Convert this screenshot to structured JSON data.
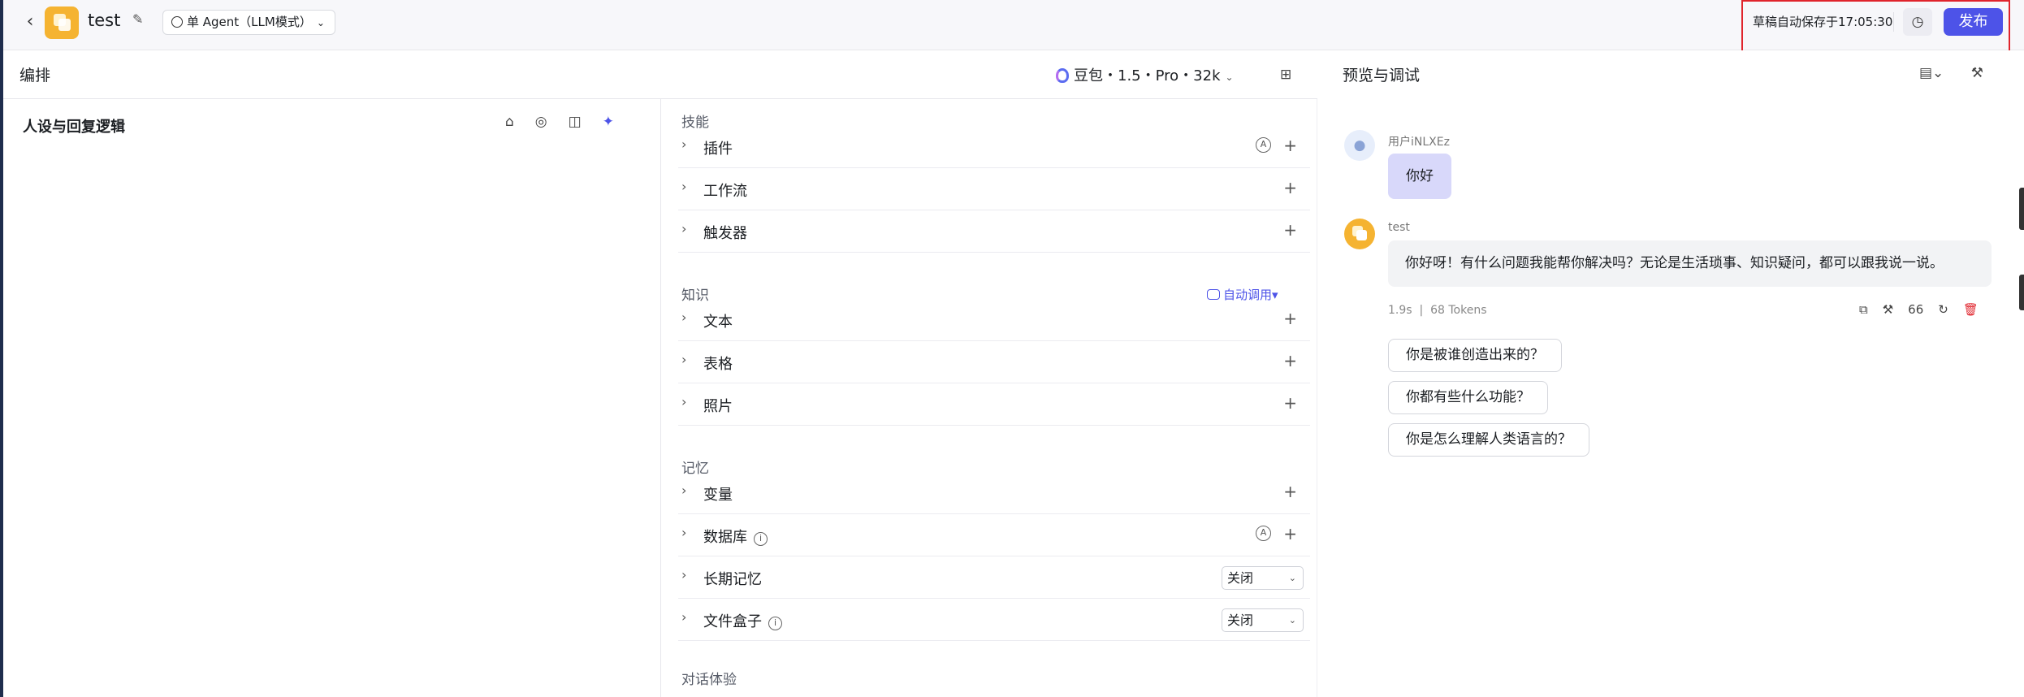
{
  "topbar": {
    "app_name": "test",
    "agent_mode": "单 Agent（LLM模式）",
    "autosave": "草稿自动保存于17:05:30",
    "publish_label": "发布"
  },
  "arrange": {
    "title": "编排",
    "model": "豆包・1.5・Pro・32k"
  },
  "persona": {
    "title": "人设与回复逻辑"
  },
  "skills": {
    "skills_title": "技能",
    "plugins": "插件",
    "workflow": "工作流",
    "trigger": "触发器",
    "knowledge_title": "知识",
    "auto_call": "自动调用",
    "text": "文本",
    "table": "表格",
    "photo": "照片",
    "memory_title": "记忆",
    "variable": "变量",
    "database": "数据库",
    "long_memory": "长期记忆",
    "long_memory_value": "关闭",
    "file_box": "文件盒子",
    "file_box_value": "关闭",
    "dialog_title": "对话体验",
    "auto_badge": "A"
  },
  "preview": {
    "title": "预览与调试",
    "user_name": "用户iNLXEz",
    "user_message": "你好",
    "bot_name": "test",
    "bot_message": "你好呀！有什么问题我能帮你解决吗？无论是生活琐事、知识疑问，都可以跟我说一说。",
    "meta_time": "1.9s",
    "meta_tokens": "68 Tokens",
    "quote_label": "66",
    "suggestions": [
      "你是被谁创造出来的？",
      "你都有些什么功能？",
      "你是怎么理解人类语言的？"
    ]
  }
}
